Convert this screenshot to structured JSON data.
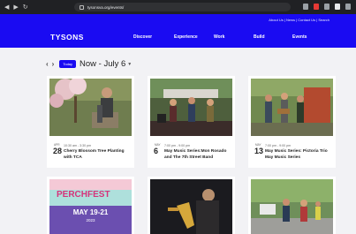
{
  "browser": {
    "url": "tysonsva.org/events/"
  },
  "site": {
    "utility_links": "About Us | News | Contact Us | Search",
    "logo": "TYSONS",
    "menu": [
      "Discover",
      "Experience",
      "Work",
      "Build",
      "Events"
    ]
  },
  "calendar": {
    "prev_icon": "chevron-left-icon",
    "next_icon": "chevron-right-icon",
    "today_label": "Today",
    "range_label": "Now - July 6"
  },
  "events": [
    {
      "month": "APR",
      "day": "28",
      "time": "10:30 am - 3:30 pm",
      "title": "Cherry Blossom Tree Planting with TCA"
    },
    {
      "month": "MAY",
      "day": "6",
      "time": "7:00 pm - 9:00 pm",
      "title": "May Music Series:Mon Rosado and The 7th Street Band"
    },
    {
      "month": "MAY",
      "day": "13",
      "time": "7:00 pm - 9:00 pm",
      "title": "May Music Series: Pictoria Trio May Music Series"
    }
  ],
  "banner": {
    "title": "PERCHFEST",
    "dates": "MAY 19-21",
    "year": "2023"
  },
  "colors": {
    "brand_blue": "#1a0bf2",
    "page_bg": "#f2f2f5"
  }
}
